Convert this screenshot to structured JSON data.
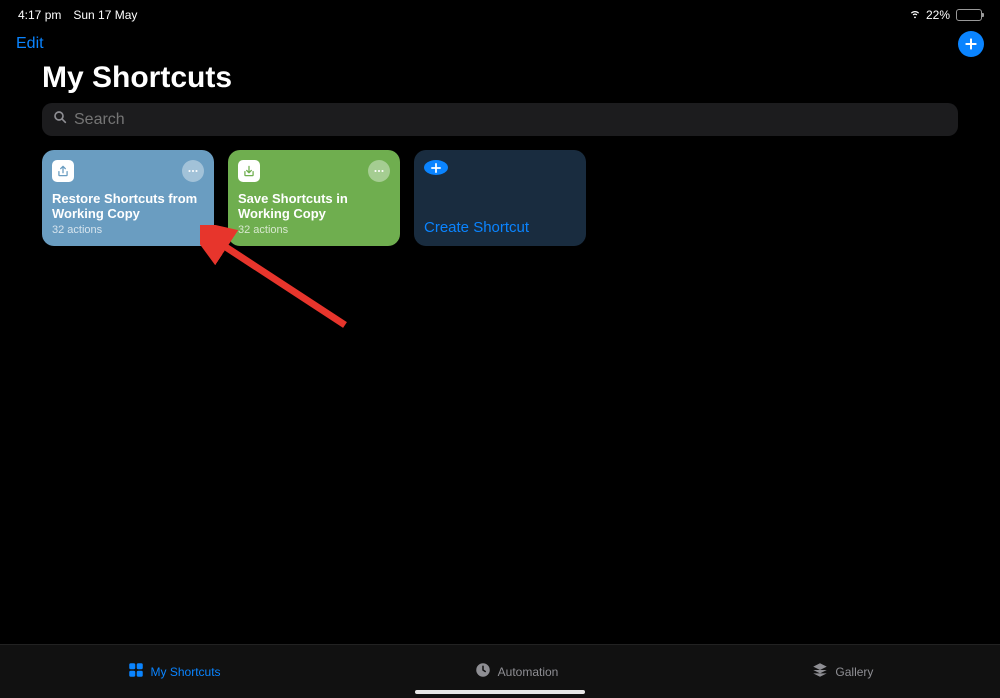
{
  "status": {
    "time": "4:17 pm",
    "date": "Sun 17 May",
    "battery": "22%"
  },
  "nav": {
    "edit": "Edit"
  },
  "title": "My Shortcuts",
  "search": {
    "placeholder": "Search"
  },
  "cards": {
    "restore": {
      "title": "Restore Shortcuts from Working Copy",
      "sub": "32 actions"
    },
    "save": {
      "title": "Save Shortcuts in Working Copy",
      "sub": "32 actions"
    },
    "create": {
      "label": "Create Shortcut"
    }
  },
  "tabs": {
    "shortcuts": "My Shortcuts",
    "automation": "Automation",
    "gallery": "Gallery"
  }
}
